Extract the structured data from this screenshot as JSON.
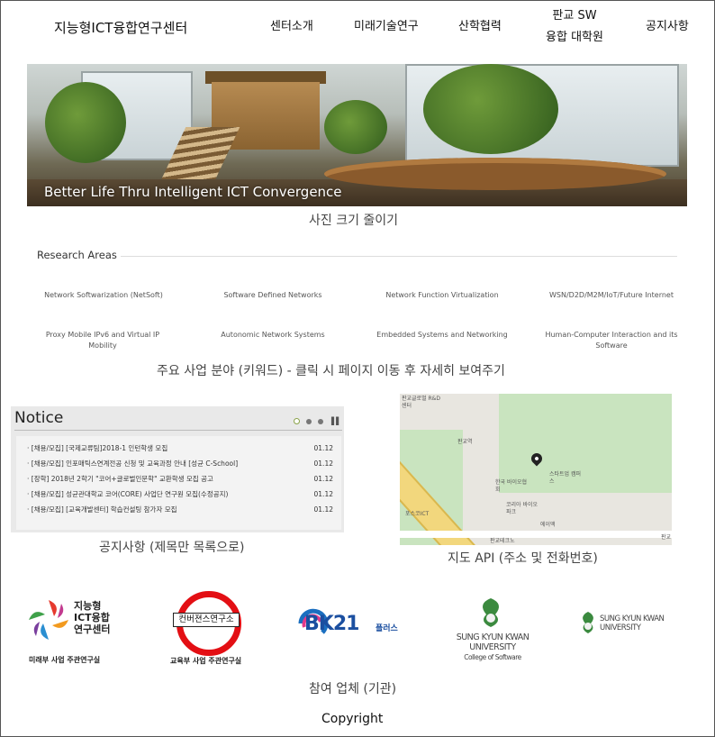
{
  "header": {
    "brand": "지능형ICT융합연구센터",
    "nav": [
      {
        "label": "센터소개"
      },
      {
        "label": "미래기술연구"
      },
      {
        "label": "산학협력"
      },
      {
        "label_line1": "판교 SW",
        "label_line2": "융합 대학원"
      },
      {
        "label": "공지사항"
      }
    ]
  },
  "hero": {
    "caption": "Better Life Thru Intelligent ICT Convergence",
    "note": "사진 크기 줄이기"
  },
  "research": {
    "title": "Research Areas",
    "items": [
      "Network Softwarization (NetSoft)",
      "Software Defined Networks",
      "Network Function Virtualization",
      "WSN/D2D/M2M/IoT/Future Internet",
      "Proxy Mobile IPv6 and Virtual IP Mobility",
      "Autonomic Network Systems",
      "Embedded Systems and Networking",
      "Human-Computer Interaction and its Software"
    ],
    "note": "주요 사업 분야 (키워드) - 클릭 시 페이지 이동 후 자세히 보여주기"
  },
  "notice": {
    "title": "Notice",
    "rows": [
      {
        "title": "· [채용/모집] [국제교류팀]2018-1 인턴학생 모집",
        "date": "01.12"
      },
      {
        "title": "· [채용/모집] 인포매틱스연계전공 신청 및 교육과정 안내 [성균 C-School]",
        "date": "01.12"
      },
      {
        "title": "· [장학] 2018년 2학기 \"코어+글로벌인문학\" 교환학생 모집 공고",
        "date": "01.12"
      },
      {
        "title": "· [채용/모집] 성균관대학교 코어(CORE) 사업단 연구원 모집(수정공지)",
        "date": "01.12"
      },
      {
        "title": "· [채용/모집] [교육개발센터] 학습컨설팅 참가자 모집",
        "date": "01.12"
      }
    ],
    "note": "공지사항 (제목만 목록으로)"
  },
  "map": {
    "labels": [
      "판교글로벌 R&D센터",
      "판교역",
      "한국 바이오협회",
      "스타트업 캠퍼스",
      "코리아 바이오파크",
      "포스코ICT",
      "에이액",
      "판교테크노",
      "판교"
    ],
    "note": "지도 API (주소 및 전화번호)"
  },
  "partners": {
    "logos": [
      {
        "line1": "지능형",
        "line2": "ICT융합",
        "line3": "연구센터",
        "caption": "미래부 사업 주관연구실"
      },
      {
        "text": "컨버젼스연구소",
        "caption": "교육부 사업 주관연구실"
      },
      {
        "text": "BK21",
        "sub": "플러스"
      },
      {
        "line1": "SUNG KYUN KWAN",
        "line2": "UNIVERSITY",
        "line3": "College of Software"
      },
      {
        "line1": "SUNG KYUN KWAN",
        "line2": "UNIVERSITY"
      }
    ],
    "note": "참여 업체 (기관)"
  },
  "footer": {
    "copyright": "Copyright"
  },
  "colors": {
    "accent": "#8aa34a",
    "noticeBg": "#e9e9e9",
    "mapGreen": "#c9e4bf",
    "mapRoad": "#f2d77d"
  }
}
